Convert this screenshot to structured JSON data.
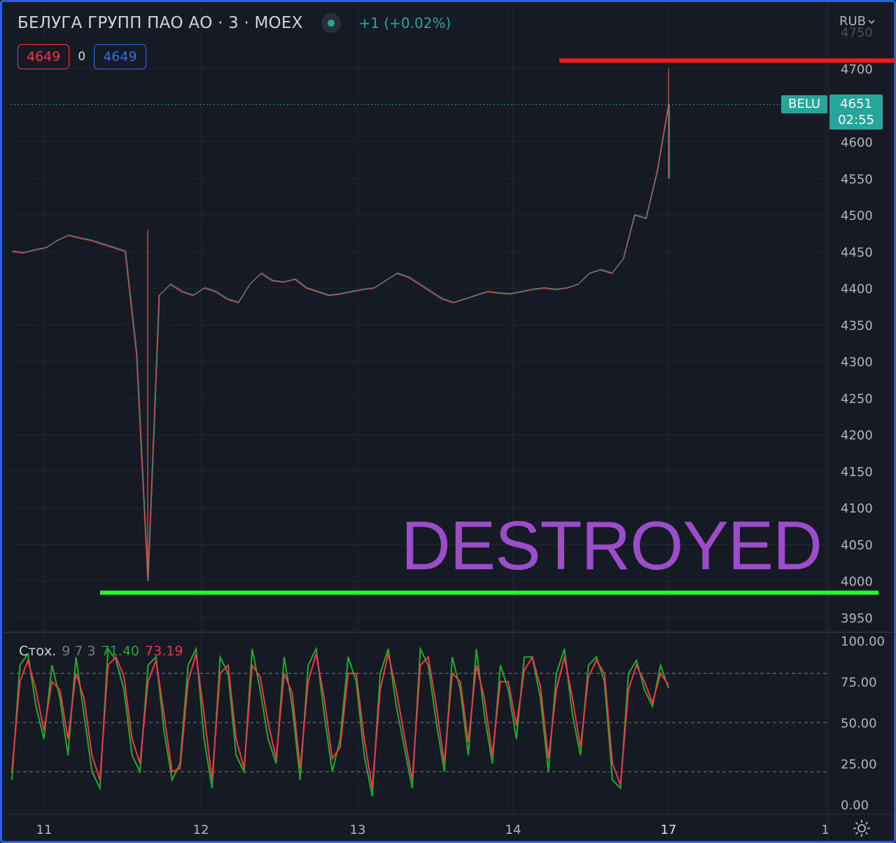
{
  "header": {
    "title": "БЕЛУГА ГРУПП ПАО АО · 3 · MOEX",
    "change": "+1 (+0.02%)",
    "bid": "4649",
    "spread": "0",
    "ask": "4649",
    "currency": "RUB"
  },
  "price_tag": {
    "symbol": "BELU",
    "price": "4651",
    "countdown": "02:55"
  },
  "stoch_legend": {
    "name": "Стох.",
    "params": "9 7 3",
    "k": "71.40",
    "d": "73.19"
  },
  "annotation": "DESTROYED",
  "colors": {
    "background": "#161a25",
    "up": "#26a69a",
    "down": "#ef5350",
    "red_line": "#ff1a1a",
    "green_line": "#22ff22",
    "annotation": "#9b4dca",
    "stoch_k": "#22ab2a",
    "stoch_d": "#f23645"
  },
  "chart_data": [
    {
      "type": "line",
      "title": "",
      "x_tick_labels": [
        "11",
        "12",
        "13",
        "14",
        "17",
        "1"
      ],
      "y_tick_labels": [
        "3950",
        "4000",
        "4050",
        "4100",
        "4150",
        "4200",
        "4250",
        "4300",
        "4350",
        "4400",
        "4450",
        "4500",
        "4550",
        "4600",
        "4700",
        "4750"
      ],
      "ylim": [
        3930,
        4760
      ],
      "last_price": 4651,
      "horizontal_lines": [
        {
          "name": "resistance",
          "value": 4711,
          "color": "red"
        },
        {
          "name": "support",
          "value": 3984,
          "color": "green"
        }
      ],
      "series": [
        {
          "values": [
            4450,
            4448,
            4452,
            4455,
            4465,
            4472,
            4468,
            4465,
            4460,
            4455,
            4450,
            4310,
            4000,
            4390,
            4405,
            4395,
            4390,
            4400,
            4395,
            4385,
            4380,
            4405,
            4420,
            4410,
            4408,
            4412,
            4400,
            4395,
            4390,
            4392,
            4395,
            4398,
            4400,
            4410,
            4420,
            4415,
            4405,
            4395,
            4385,
            4380,
            4385,
            4390,
            4395,
            4393,
            4392,
            4395,
            4398,
            4400,
            4398,
            4400,
            4405,
            4420,
            4425,
            4420,
            4440,
            4500,
            4495,
            4560,
            4651
          ],
          "lows": [
            {
              "value": 4000
            }
          ],
          "highs": [
            {
              "value": 4700
            }
          ]
        }
      ]
    },
    {
      "type": "line",
      "title": "Стох.",
      "ylim": [
        0,
        100
      ],
      "y_tick_labels": [
        "0.00",
        "25.00",
        "50.00",
        "75.00",
        "100.00"
      ],
      "bands": [
        20,
        50,
        80
      ],
      "series": [
        {
          "name": "K",
          "values": [
            15,
            85,
            92,
            60,
            40,
            85,
            65,
            30,
            90,
            55,
            20,
            10,
            95,
            88,
            70,
            30,
            20,
            85,
            90,
            45,
            15,
            25,
            85,
            95,
            40,
            10,
            90,
            80,
            30,
            20,
            95,
            70,
            40,
            25,
            90,
            60,
            15,
            85,
            95,
            55,
            20,
            40,
            90,
            75,
            30,
            5,
            80,
            95,
            60,
            35,
            10,
            95,
            85,
            50,
            20,
            90,
            70,
            30,
            95,
            55,
            25,
            85,
            70,
            40,
            90,
            90,
            65,
            20,
            80,
            95,
            55,
            30,
            85,
            90,
            75,
            15,
            10,
            80,
            88,
            70,
            60,
            85,
            71
          ]
        },
        {
          "name": "D",
          "values": [
            20,
            75,
            88,
            70,
            45,
            75,
            70,
            40,
            80,
            65,
            30,
            15,
            85,
            90,
            78,
            40,
            25,
            75,
            88,
            55,
            20,
            22,
            75,
            92,
            55,
            15,
            80,
            85,
            40,
            22,
            85,
            78,
            50,
            28,
            80,
            68,
            22,
            75,
            92,
            65,
            28,
            35,
            80,
            80,
            40,
            10,
            70,
            92,
            70,
            42,
            15,
            85,
            90,
            60,
            25,
            80,
            75,
            38,
            85,
            65,
            30,
            75,
            75,
            48,
            82,
            90,
            72,
            28,
            70,
            90,
            65,
            35,
            78,
            88,
            80,
            25,
            12,
            70,
            85,
            75,
            62,
            80,
            73
          ]
        }
      ]
    }
  ]
}
